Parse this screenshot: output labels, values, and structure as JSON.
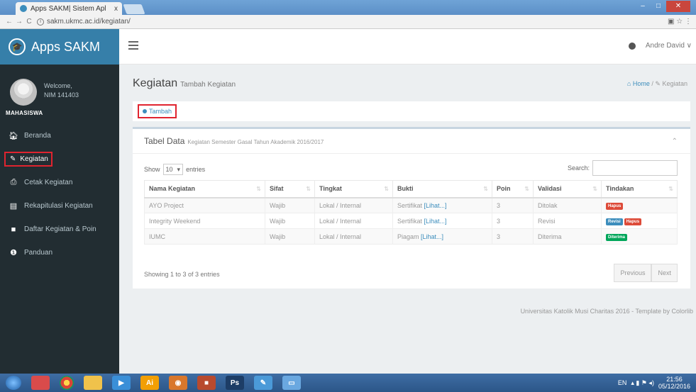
{
  "browser": {
    "tab_title": "Apps SAKM| Sistem Apl",
    "tab_close": "x",
    "url": "sakm.ukmc.ac.id/kegiatan/",
    "back": "←",
    "forward": "→",
    "reload": "C",
    "info_icon": "i",
    "ext_icons": "▣ ☆ ⋮"
  },
  "sidebar": {
    "brand": "Apps SAKM",
    "welcome": "Welcome,",
    "nim": "NIM 141403",
    "role": "MAHASISWA",
    "items": [
      {
        "label": "Beranda",
        "icon": "home-icon"
      },
      {
        "label": "Kegiatan",
        "icon": "edit-icon"
      },
      {
        "label": "Cetak Kegiatan",
        "icon": "printer-icon"
      },
      {
        "label": "Rekapitulasi Kegiatan",
        "icon": "document-icon"
      },
      {
        "label": "Daftar Kegiatan & Poin",
        "icon": "folder-icon"
      },
      {
        "label": "Panduan",
        "icon": "info-icon"
      }
    ]
  },
  "navbar": {
    "user": "Andre David ∨"
  },
  "page": {
    "title": "Kegiatan",
    "subtitle": "Tambah Kegiatan",
    "breadcrumb_home": "Home",
    "breadcrumb_sep": "/",
    "breadcrumb_current": "Kegiatan",
    "tambah_label": "Tambah"
  },
  "panel": {
    "title": "Tabel Data",
    "subtitle": "Kegiatan Semester Gasal Tahun Akademik 2016/2017",
    "collapse": "⌃",
    "show_label": "Show",
    "show_value": "10",
    "entries_label": "entries",
    "search_label": "Search:",
    "search_value": ""
  },
  "table": {
    "columns": [
      "Nama Kegiatan",
      "Sifat",
      "Tingkat",
      "Bukti",
      "Poin",
      "Validasi",
      "Tindakan"
    ],
    "rows": [
      {
        "nama": "AYO Project",
        "sifat": "Wajib",
        "tingkat": "Lokal / Internal",
        "bukti": "Sertifikat",
        "bukti_link": "[Lihat...]",
        "poin": "3",
        "validasi": "Ditolak",
        "actions": [
          {
            "label": "Hapus",
            "color": "#dd4b39"
          }
        ]
      },
      {
        "nama": "Integrity Weekend",
        "sifat": "Wajib",
        "tingkat": "Lokal / Internal",
        "bukti": "Sertifikat",
        "bukti_link": "[Lihat...]",
        "poin": "3",
        "validasi": "Revisi",
        "actions": [
          {
            "label": "Revisi",
            "color": "#3c8dbc"
          },
          {
            "label": "Hapus",
            "color": "#dd4b39"
          }
        ]
      },
      {
        "nama": "IUMC",
        "sifat": "Wajib",
        "tingkat": "Lokal / Internal",
        "bukti": "Piagam",
        "bukti_link": "[Lihat...]",
        "poin": "3",
        "validasi": "Diterima",
        "actions": [
          {
            "label": "Diterima",
            "color": "#00a65a"
          }
        ]
      }
    ],
    "info": "Showing 1 to 3 of 3 entries",
    "prev": "Previous",
    "next": "Next"
  },
  "footer": "Universitas Katolik Musi Charitas 2016 - Template by Colorlib",
  "taskbar": {
    "lang": "EN",
    "time": "21:56",
    "date": "05/12/2016"
  }
}
